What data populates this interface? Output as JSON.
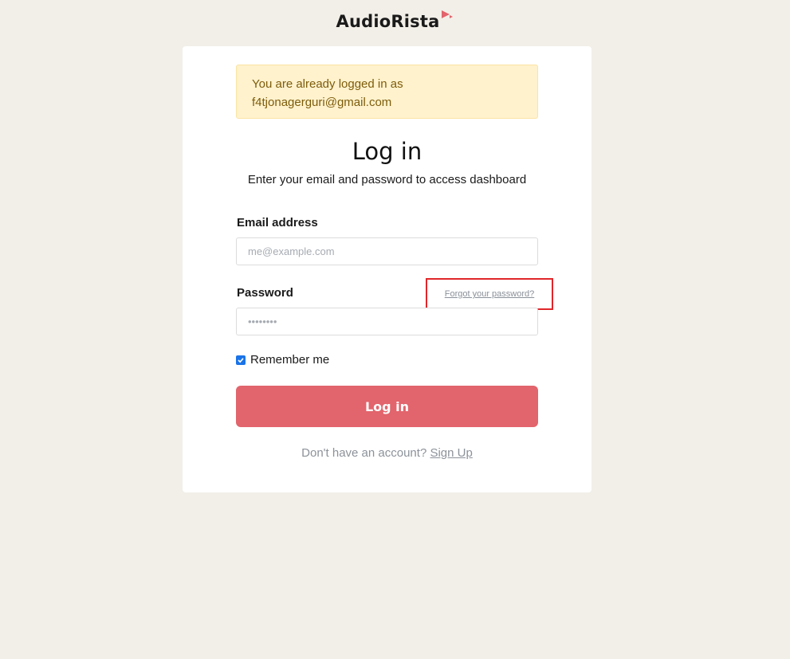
{
  "brand": {
    "name": "AudioRista",
    "accent_color": "#e2646c"
  },
  "alert": {
    "line1": "You are already logged in as",
    "line2": "f4tjonagerguri@gmail.com"
  },
  "form": {
    "title": "Log in",
    "subtitle": "Enter your email and password to access dashboard",
    "email": {
      "label": "Email address",
      "placeholder": "me@example.com",
      "value": ""
    },
    "password": {
      "label": "Password",
      "placeholder": "••••••••",
      "value": "",
      "forgot_link": "Forgot your password?"
    },
    "remember": {
      "label": "Remember me",
      "checked": true
    },
    "submit_label": "Log in",
    "signup": {
      "prompt": "Don't have an account?",
      "link": "Sign Up"
    }
  },
  "colors": {
    "page_background": "#f2efe8",
    "alert_background": "#fff2cd",
    "button": "#e2646c",
    "highlight_box": "#e0262a"
  }
}
